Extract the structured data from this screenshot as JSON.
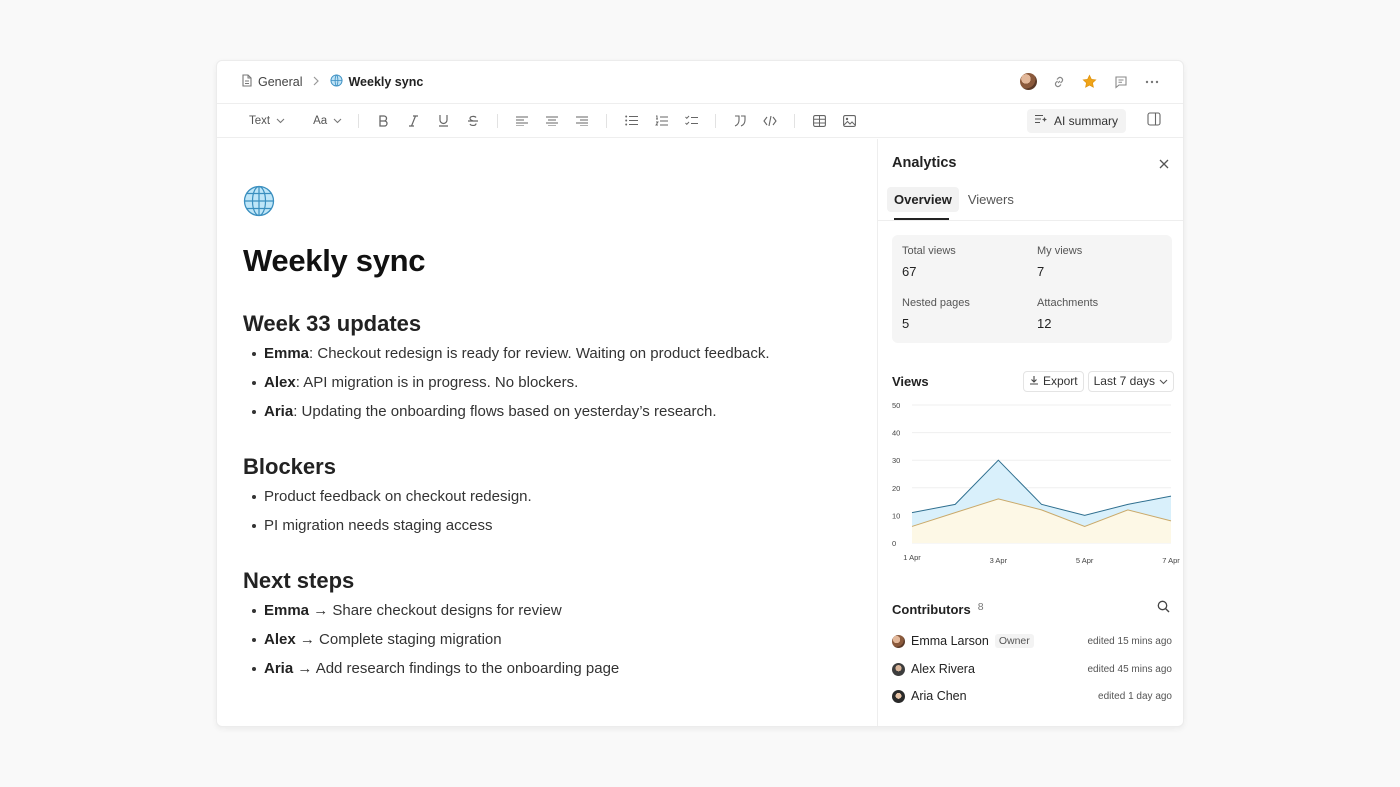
{
  "breadcrumb": {
    "parent": "General",
    "current": "Weekly sync",
    "current_icon": "globe-icon"
  },
  "toolbar": {
    "text_style": "Text",
    "font_size": "Aa",
    "ai_summary": "AI summary"
  },
  "doc": {
    "emoji": "🌐",
    "title": "Weekly sync",
    "sections": [
      {
        "heading": "Week 33 updates",
        "items": [
          {
            "name": "Emma",
            "text": ": Checkout redesign is ready for review. Waiting on product feedback."
          },
          {
            "name": "Alex",
            "text": ": API migration is in progress. No blockers."
          },
          {
            "name": "Aria",
            "text": ": Updating the onboarding flows based on yesterday’s research."
          }
        ]
      },
      {
        "heading": "Blockers",
        "items": [
          {
            "name": "",
            "text": "Product feedback on checkout redesign."
          },
          {
            "name": "",
            "text": "PI migration needs staging access"
          }
        ]
      },
      {
        "heading": "Next steps",
        "items": [
          {
            "name": "Emma",
            "text": " → Share checkout designs for review"
          },
          {
            "name": "Alex",
            "text": " → Complete staging migration"
          },
          {
            "name": "Aria",
            "text": " → Add research findings to the onboarding page"
          }
        ]
      }
    ]
  },
  "analytics": {
    "title": "Analytics",
    "tabs": [
      "Overview",
      "Viewers"
    ],
    "active_tab": "Overview",
    "stats": {
      "total_views_label": "Total views",
      "total_views": "67",
      "my_views_label": "My views",
      "my_views": "7",
      "nested_pages_label": "Nested pages",
      "nested_pages": "5",
      "attachments_label": "Attachments",
      "attachments": "12"
    },
    "views": {
      "title": "Views",
      "export": "Export",
      "range": "Last 7 days"
    },
    "contributors": {
      "title": "Contributors",
      "count": "8",
      "list": [
        {
          "name": "Emma Larson",
          "badge": "Owner",
          "time": "edited 15 mins ago"
        },
        {
          "name": "Alex Rivera",
          "badge": "",
          "time": "edited 45 mins ago"
        },
        {
          "name": "Aria Chen",
          "badge": "",
          "time": "edited 1 day ago"
        }
      ]
    }
  },
  "chart_data": {
    "type": "area",
    "x": [
      "1 Apr",
      "2 Apr",
      "3 Apr",
      "4 Apr",
      "5 Apr",
      "6 Apr",
      "7 Apr"
    ],
    "x_tick_labels": [
      "1 Apr",
      "3 Apr",
      "5 Apr",
      "7 Apr"
    ],
    "ylim": [
      0,
      50
    ],
    "y_ticks": [
      0,
      10,
      20,
      30,
      40,
      50
    ],
    "series": [
      {
        "values": [
          11,
          14,
          30,
          14,
          10,
          14,
          17
        ],
        "color": "#2f6f8f",
        "fill": "#d9f0fb"
      },
      {
        "values": [
          6,
          11,
          16,
          12,
          6,
          12,
          8
        ],
        "color": "#c9a96a",
        "fill": "#fdf8e6"
      }
    ]
  }
}
